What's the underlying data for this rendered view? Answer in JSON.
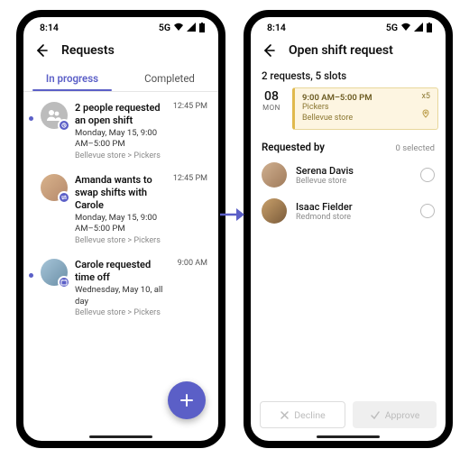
{
  "status": {
    "time": "8:14",
    "net": "5G"
  },
  "left": {
    "title": "Requests",
    "tabs": {
      "active": "In progress",
      "inactive": "Completed"
    },
    "items": [
      {
        "title": "2 people requested an open shift",
        "when": "Monday, May 15, 9:00 AM–5:00 PM",
        "crumb": "Bellevue store > Pickers",
        "time": "12:45 PM",
        "unread": true,
        "icon": "group"
      },
      {
        "title": "Amanda wants to swap shifts with Carole",
        "when": "Monday, May 15, 9:00 AM–5:00 PM",
        "crumb": "Bellevue store > Pickers",
        "time": "12:45 PM",
        "unread": false,
        "icon": "swap"
      },
      {
        "title": "Carole requested time off",
        "when": "Wednesday, May 10, all day",
        "crumb": "Bellevue store > Pickers",
        "time": "9:00 AM",
        "unread": true,
        "icon": "timeoff"
      }
    ]
  },
  "right": {
    "title": "Open shift request",
    "summary": "2 requests, 5 slots",
    "date": {
      "num": "08",
      "day": "MON"
    },
    "shift": {
      "time": "9:00 AM–5:00 PM",
      "role": "Pickers",
      "store": "Bellevue store",
      "slots": "x5"
    },
    "section": {
      "title": "Requested by",
      "selected": "0 selected"
    },
    "people": [
      {
        "name": "Serena Davis",
        "loc": "Bellevue store"
      },
      {
        "name": "Isaac Fielder",
        "loc": "Redmond store"
      }
    ],
    "decline": "Decline",
    "approve": "Approve"
  }
}
